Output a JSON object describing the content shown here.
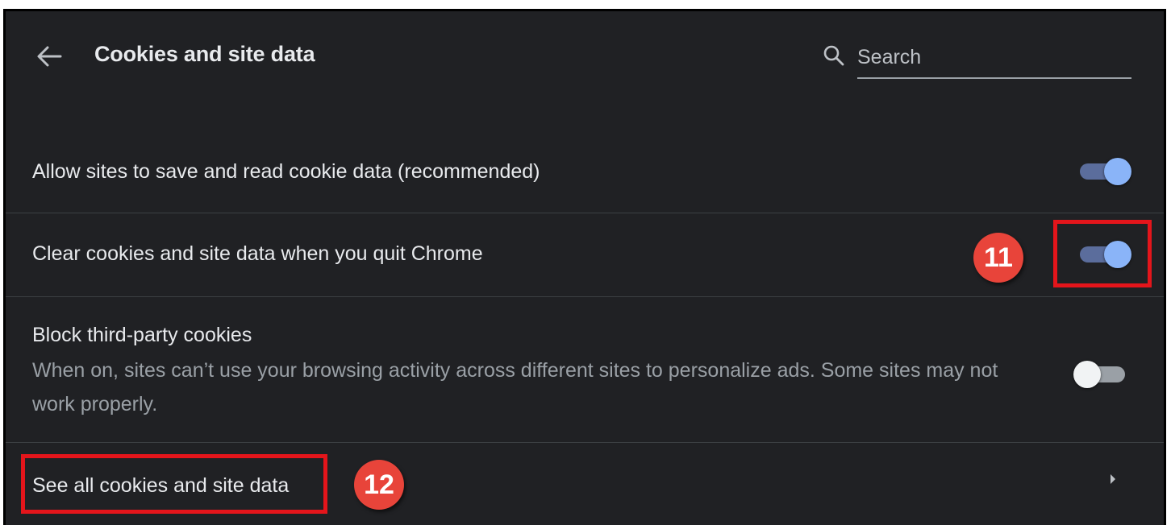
{
  "header": {
    "title": "Cookies and site data",
    "back_icon": "arrow-back-icon",
    "search": {
      "icon": "search-icon",
      "placeholder": "Search",
      "value": ""
    }
  },
  "settings": [
    {
      "label": "Allow sites to save and read cookie data (recommended)",
      "toggle": "on"
    },
    {
      "label": "Clear cookies and site data when you quit Chrome",
      "toggle": "on"
    },
    {
      "label": "Block third-party cookies",
      "sublabel": "When on, sites can’t use your browsing activity across different sites to personalize ads. Some sites may not work properly.",
      "toggle": "off"
    },
    {
      "label": "See all cookies and site data",
      "icon": "chevron-right-icon"
    }
  ],
  "annotations": {
    "step_11": "11",
    "step_12": "12"
  },
  "colors": {
    "background": "#202124",
    "text": "#e8eaed",
    "secondary_text": "#9aa0a6",
    "toggle_on": "#8ab4f8",
    "annotation_red": "#e4151b",
    "badge_red": "#e8443a"
  }
}
